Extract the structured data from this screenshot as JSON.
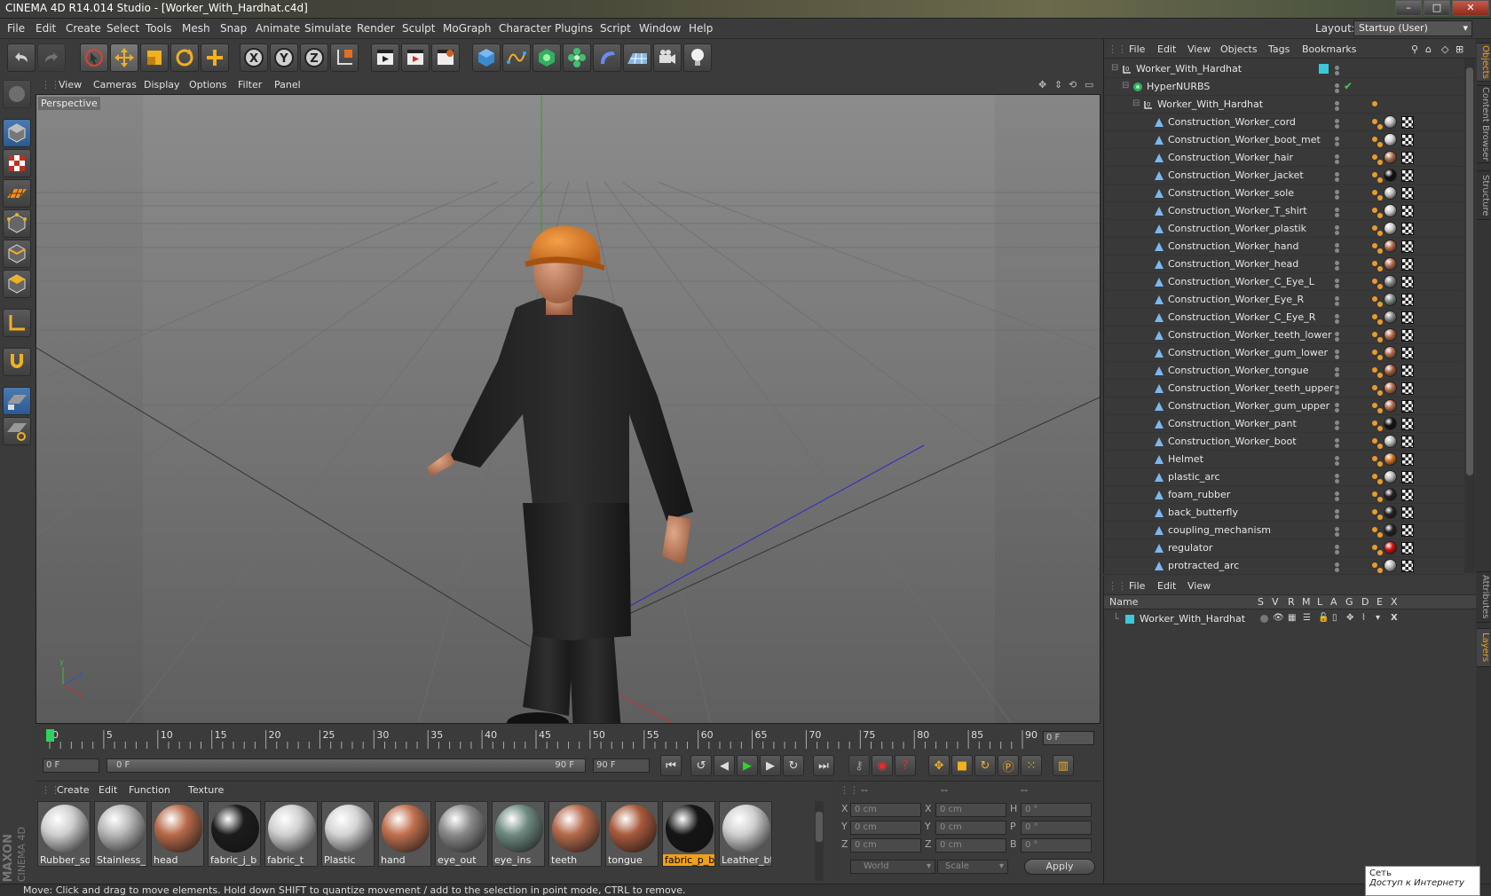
{
  "window": {
    "title": "CINEMA 4D R14.014 Studio - [Worker_With_Hardhat.c4d]",
    "minimize": "–",
    "maximize": "□",
    "close": "✕"
  },
  "menubar": {
    "items": [
      "File",
      "Edit",
      "Create",
      "Select",
      "Tools",
      "Mesh",
      "Snap",
      "Animate",
      "Simulate",
      "Render",
      "Sculpt",
      "MoGraph",
      "Character",
      "Plugins",
      "Script",
      "Window",
      "Help"
    ],
    "layout_label": "Layout:",
    "layout_value": "Startup (User)"
  },
  "viewport": {
    "menu": [
      "View",
      "Cameras",
      "Display",
      "Options",
      "Filter",
      "Panel"
    ],
    "label": "Perspective"
  },
  "timeline": {
    "ticks": [
      "0",
      "5",
      "10",
      "15",
      "20",
      "25",
      "30",
      "35",
      "40",
      "45",
      "50",
      "55",
      "60",
      "65",
      "70",
      "75",
      "80",
      "85",
      "90"
    ],
    "current_frame": "0 F",
    "start_field": "0 F",
    "range_start": "0 F",
    "range_end": "90 F",
    "end_field": "90 F"
  },
  "materials": {
    "menu": [
      "Create",
      "Edit",
      "Function",
      "Texture"
    ],
    "items": [
      {
        "name": "Rubber_so",
        "color": "#cfcfcf"
      },
      {
        "name": "Stainless_",
        "color": "#b8b8b8"
      },
      {
        "name": "head",
        "color": "#b86a4a"
      },
      {
        "name": "fabric_j_b",
        "color": "#1c1c1c"
      },
      {
        "name": "fabric_t",
        "color": "#d0d0d0"
      },
      {
        "name": "Plastic",
        "color": "#d4d4d4"
      },
      {
        "name": "hand",
        "color": "#c0704e"
      },
      {
        "name": "eye_out",
        "color": "#8a8a8a"
      },
      {
        "name": "eye_ins",
        "color": "#6e8a80"
      },
      {
        "name": "teeth",
        "color": "#b46a4c"
      },
      {
        "name": "tongue",
        "color": "#a85a3c"
      },
      {
        "name": "fabric_p_b",
        "color": "#151515"
      },
      {
        "name": "Leather_bt",
        "color": "#cfcfcf"
      }
    ],
    "selected_index": 11
  },
  "coords": {
    "headers": [
      "--",
      "--",
      "--"
    ],
    "rows": [
      {
        "a": "X",
        "av": "0 cm",
        "b": "X",
        "bv": "0 cm",
        "c": "H",
        "cv": "0 °"
      },
      {
        "a": "Y",
        "av": "0 cm",
        "b": "Y",
        "bv": "0 cm",
        "c": "P",
        "cv": "0 °"
      },
      {
        "a": "Z",
        "av": "0 cm",
        "b": "Z",
        "bv": "0 cm",
        "c": "B",
        "cv": "0 °"
      }
    ],
    "mode1": "World",
    "mode2": "Scale",
    "apply": "Apply"
  },
  "status": "Move: Click and drag to move elements. Hold down SHIFT to quantize movement / add to the selection in point mode, CTRL to remove.",
  "objects": {
    "menu": [
      "File",
      "Edit",
      "View",
      "Objects",
      "Tags",
      "Bookmarks"
    ],
    "rows": [
      {
        "name": "Worker_With_Hardhat",
        "indent": 0,
        "type": "null",
        "ball": ""
      },
      {
        "name": "HyperNURBS",
        "indent": 1,
        "type": "nurbs",
        "ball": ""
      },
      {
        "name": "Worker_With_Hardhat",
        "indent": 2,
        "type": "null",
        "ball": ""
      },
      {
        "name": "Construction_Worker_cord",
        "indent": 3,
        "type": "poly",
        "ball": "#bbbbbb"
      },
      {
        "name": "Construction_Worker_boot_met",
        "indent": 3,
        "type": "poly",
        "ball": "#d0d0d0"
      },
      {
        "name": "Construction_Worker_hair",
        "indent": 3,
        "type": "poly",
        "ball": "#a86a4a"
      },
      {
        "name": "Construction_Worker_jacket",
        "indent": 3,
        "type": "poly",
        "ball": "#111111"
      },
      {
        "name": "Construction_Worker_sole",
        "indent": 3,
        "type": "poly",
        "ball": "#bbbbbb"
      },
      {
        "name": "Construction_Worker_T_shirt",
        "indent": 3,
        "type": "poly",
        "ball": "#cccccc"
      },
      {
        "name": "Construction_Worker_plastik",
        "indent": 3,
        "type": "poly",
        "ball": "#cccccc"
      },
      {
        "name": "Construction_Worker_hand",
        "indent": 3,
        "type": "poly",
        "ball": "#b06a4a"
      },
      {
        "name": "Construction_Worker_head",
        "indent": 3,
        "type": "poly",
        "ball": "#b06a4a"
      },
      {
        "name": "Construction_Worker_C_Eye_L",
        "indent": 3,
        "type": "poly",
        "ball": "#888888"
      },
      {
        "name": "Construction_Worker_Eye_R",
        "indent": 3,
        "type": "poly",
        "ball": "#7a8a80"
      },
      {
        "name": "Construction_Worker_C_Eye_R",
        "indent": 3,
        "type": "poly",
        "ball": "#888888"
      },
      {
        "name": "Construction_Worker_teeth_lower",
        "indent": 3,
        "type": "poly",
        "ball": "#b06a4a"
      },
      {
        "name": "Construction_Worker_gum_lower",
        "indent": 3,
        "type": "poly",
        "ball": "#b06a4a"
      },
      {
        "name": "Construction_Worker_tongue",
        "indent": 3,
        "type": "poly",
        "ball": "#a85a3c"
      },
      {
        "name": "Construction_Worker_teeth_upper",
        "indent": 3,
        "type": "poly",
        "ball": "#b06a4a"
      },
      {
        "name": "Construction_Worker_gum_upper",
        "indent": 3,
        "type": "poly",
        "ball": "#b06a4a"
      },
      {
        "name": "Construction_Worker_pant",
        "indent": 3,
        "type": "poly",
        "ball": "#111111"
      },
      {
        "name": "Construction_Worker_boot",
        "indent": 3,
        "type": "poly",
        "ball": "#bbbbbb"
      },
      {
        "name": "Helmet",
        "indent": 3,
        "type": "poly",
        "ball": "#d07020"
      },
      {
        "name": "plastic_arc",
        "indent": 3,
        "type": "poly",
        "ball": "#bbbbbb"
      },
      {
        "name": "foam_rubber",
        "indent": 3,
        "type": "poly",
        "ball": "#222222"
      },
      {
        "name": "back_butterfly",
        "indent": 3,
        "type": "poly",
        "ball": "#222222"
      },
      {
        "name": "coupling_mechanism",
        "indent": 3,
        "type": "poly",
        "ball": "#222222"
      },
      {
        "name": "regulator",
        "indent": 3,
        "type": "poly",
        "ball": "#d01010"
      },
      {
        "name": "protracted_arc",
        "indent": 3,
        "type": "poly",
        "ball": "#bbbbbb"
      }
    ]
  },
  "layers": {
    "menu": [
      "File",
      "Edit",
      "View"
    ],
    "headers": [
      "Name",
      "S",
      "V",
      "R",
      "M",
      "L",
      "A",
      "G",
      "D",
      "E",
      "X"
    ],
    "row_name": "Worker_With_Hardhat",
    "row_color": "#3cc8d8"
  },
  "side_tabs": [
    "Objects",
    "Content Browser",
    "Structure",
    "Attributes",
    "Layers"
  ],
  "network": {
    "line1": "Сеть",
    "line2": "Доступ к Интернету"
  },
  "brand": {
    "line1": "MAXON",
    "line2": "CINEMA 4D"
  },
  "colors": {
    "accent": "#f0a01a",
    "layer": "#3cc8d8"
  }
}
